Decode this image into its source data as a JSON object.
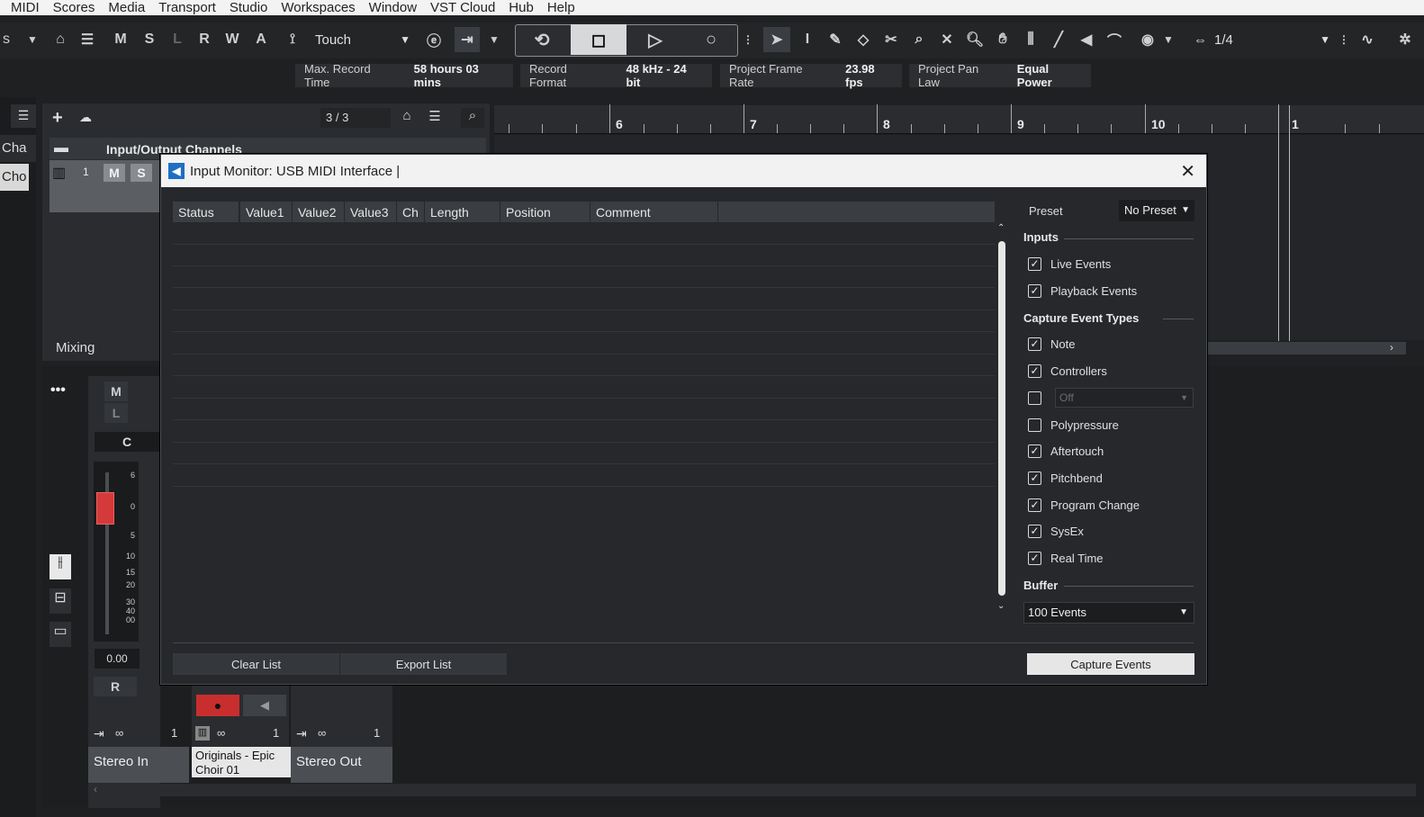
{
  "menu": [
    "MIDI",
    "Scores",
    "Media",
    "Transport",
    "Studio",
    "Workspaces",
    "Window",
    "VST Cloud",
    "Hub",
    "Help"
  ],
  "toolbar": {
    "left_label": "s",
    "mixer_modes": [
      "M",
      "S",
      "L",
      "R",
      "W",
      "A"
    ],
    "automation_mode": "Touch",
    "quantize": "1/4"
  },
  "status": {
    "max_record_label": "Max. Record Time",
    "max_record_value": "58 hours 03 mins",
    "record_format_label": "Record Format",
    "record_format_value": "48 kHz - 24 bit",
    "frame_rate_label": "Project Frame Rate",
    "frame_rate_value": "23.98 fps",
    "pan_law_label": "Project Pan Law",
    "pan_law_value": "Equal Power"
  },
  "project": {
    "track_count": "3 / 3",
    "folder_name": "Input/Output Channels",
    "left_tab1": "Cha",
    "left_tab2": "Cho",
    "mixing_label": "Mixing",
    "track_number": "1",
    "ruler_marks": [
      "6",
      "7",
      "8",
      "9",
      "10",
      "1"
    ]
  },
  "mixer": {
    "volume_value": "0.00",
    "pan_value": "C",
    "scale": [
      "6",
      "0",
      "5",
      "10",
      "15",
      "20",
      "30",
      "40",
      "00"
    ],
    "channels": [
      {
        "name": "Stereo In",
        "number": "1"
      },
      {
        "name": "Originals - Epic Choir 01",
        "number": "1"
      },
      {
        "name": "Stereo Out",
        "number": "1"
      }
    ]
  },
  "dialog": {
    "title": "Input Monitor: USB MIDI Interface |",
    "columns": [
      "Status",
      "Value1",
      "Value2",
      "Value3",
      "Ch",
      "Length",
      "Position",
      "Comment"
    ],
    "preset_label": "Preset",
    "preset_value": "No Preset",
    "inputs_label": "Inputs",
    "inputs": [
      {
        "label": "Live Events",
        "checked": true
      },
      {
        "label": "Playback Events",
        "checked": true
      }
    ],
    "capture_label": "Capture Event Types",
    "capture_types": [
      {
        "label": "Note",
        "checked": true
      },
      {
        "label": "Controllers",
        "checked": true
      },
      {
        "label": "",
        "checked": false,
        "dropdown": "Off"
      },
      {
        "label": "Polypressure",
        "checked": false
      },
      {
        "label": "Aftertouch",
        "checked": true
      },
      {
        "label": "Pitchbend",
        "checked": true
      },
      {
        "label": "Program Change",
        "checked": true
      },
      {
        "label": "SysEx",
        "checked": true
      },
      {
        "label": "Real Time",
        "checked": true
      }
    ],
    "buffer_label": "Buffer",
    "buffer_value": "100 Events",
    "clear_button": "Clear List",
    "export_button": "Export List",
    "capture_button": "Capture Events"
  }
}
